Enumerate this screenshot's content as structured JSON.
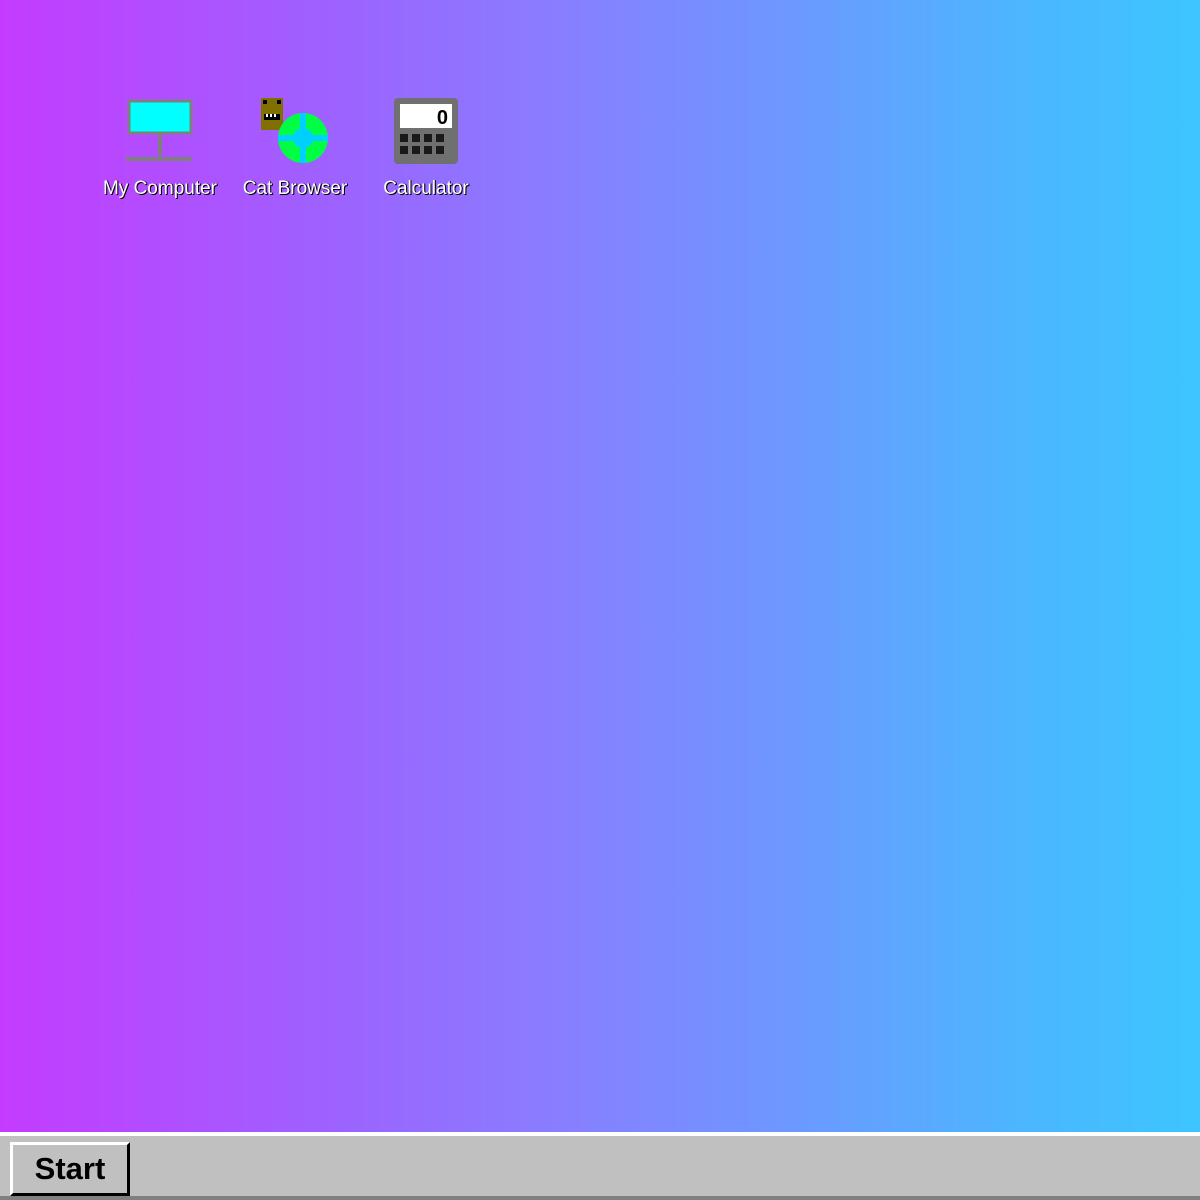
{
  "desktop": {
    "background_colors": [
      "#c43bff",
      "#3dc5ff"
    ],
    "icons": [
      {
        "label": "My Computer",
        "icon": "monitor-icon"
      },
      {
        "label": "Cat Browser",
        "icon": "cat-globe-icon"
      },
      {
        "label": "Calculator",
        "icon": "calculator-icon"
      }
    ],
    "calculator_icon_display": "0"
  },
  "taskbar": {
    "start_label": "Start"
  }
}
